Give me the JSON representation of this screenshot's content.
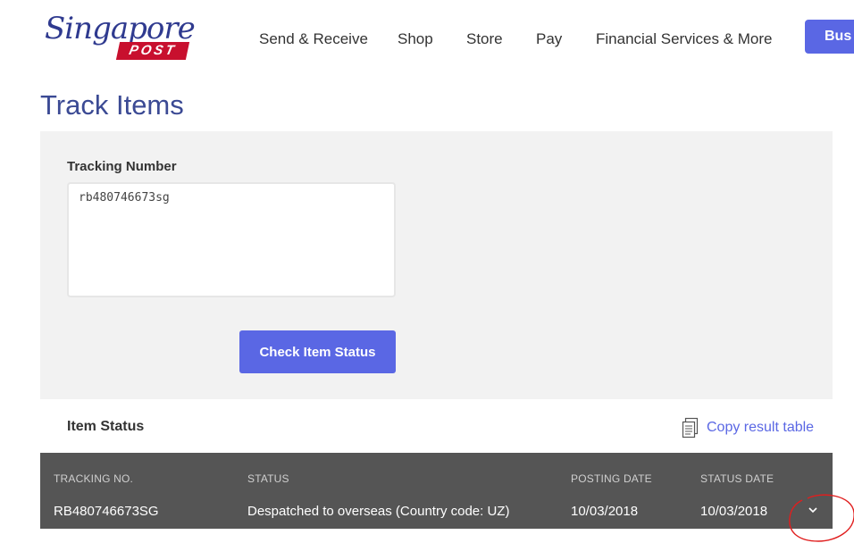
{
  "header": {
    "logo_script": "Singapore",
    "logo_post": "POST",
    "nav": [
      {
        "label": "Send & Receive"
      },
      {
        "label": "Shop"
      },
      {
        "label": "Store"
      },
      {
        "label": "Pay"
      },
      {
        "label": "Financial Services & More"
      }
    ],
    "business_button": "Bus"
  },
  "page": {
    "title": "Track Items"
  },
  "form": {
    "label": "Tracking Number",
    "value": "rb480746673sg",
    "submit_label": "Check Item Status"
  },
  "results": {
    "heading": "Item Status",
    "copy_label": "Copy result table",
    "columns": [
      "TRACKING NO.",
      "STATUS",
      "POSTING DATE",
      "STATUS DATE"
    ],
    "rows": [
      {
        "tracking_no": "RB480746673SG",
        "status": "Despatched to overseas (Country code: UZ)",
        "posting_date": "10/03/2018",
        "status_date": "10/03/2018"
      }
    ]
  },
  "colors": {
    "accent": "#5a67e4",
    "title": "#3b4a94",
    "panel": "#f2f2f2",
    "table_bg": "#555555",
    "brand_red": "#c8102e",
    "annotation": "#e01e1e"
  },
  "icons": {
    "copy": "document-copy-icon",
    "expand": "chevron-down-icon"
  }
}
